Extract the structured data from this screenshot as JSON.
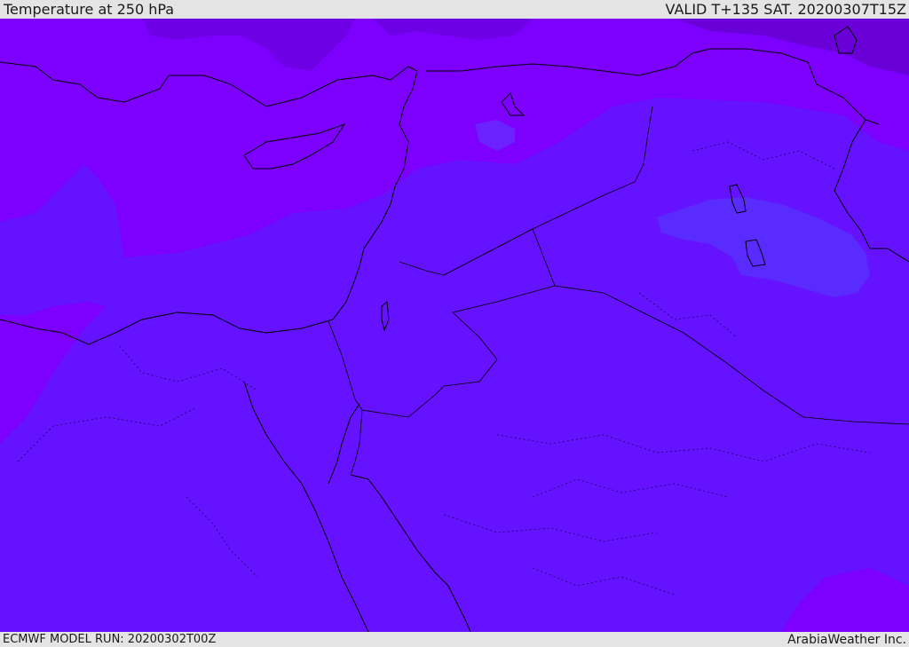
{
  "header": {
    "title": "Temperature at 250 hPa",
    "valid": "VALID T+135 SAT. 20200307T15Z"
  },
  "footer": {
    "model_run": "ECMWF MODEL RUN: 20200302T00Z",
    "credit": "ArabiaWeather Inc."
  },
  "colors": {
    "warm_band": "#7d00ff",
    "mid_band": "#6412ff",
    "cool_band": "#5a2bff",
    "coldest_band": "#6a00d8",
    "coastline": "#000000"
  }
}
